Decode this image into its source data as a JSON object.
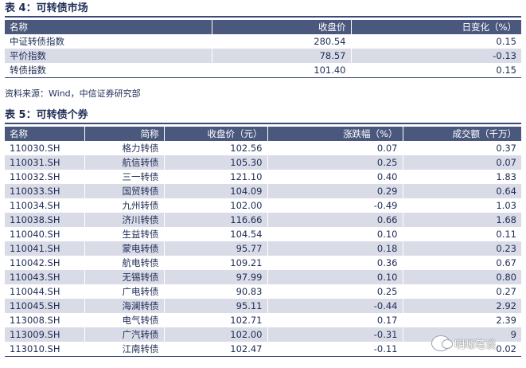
{
  "table4": {
    "title": "表 4：可转债市场",
    "headers": [
      "名称",
      "收盘价",
      "日变化（%）"
    ],
    "rows": [
      [
        "中证转债指数",
        "280.54",
        "0.15"
      ],
      [
        "平价指数",
        "78.57",
        "-0.13"
      ],
      [
        "转债指数",
        "101.40",
        "0.15"
      ]
    ]
  },
  "source": "资料来源：Wind，中信证券研究部",
  "table5": {
    "title": "表 5：可转债个券",
    "headers": [
      "名称",
      "简称",
      "收盘价（元）",
      "涨跌幅（%）",
      "成交额（千万）"
    ],
    "rows": [
      [
        "110030.SH",
        "格力转债",
        "102.56",
        "0.07",
        "0.37"
      ],
      [
        "110031.SH",
        "航信转债",
        "105.30",
        "0.25",
        "0.07"
      ],
      [
        "110032.SH",
        "三一转债",
        "121.10",
        "0.40",
        "1.83"
      ],
      [
        "110033.SH",
        "国贸转债",
        "104.09",
        "0.29",
        "0.64"
      ],
      [
        "110034.SH",
        "九州转债",
        "102.00",
        "-0.49",
        "1.03"
      ],
      [
        "110038.SH",
        "济川转债",
        "116.66",
        "0.66",
        "1.68"
      ],
      [
        "110040.SH",
        "生益转债",
        "104.54",
        "0.10",
        "0.11"
      ],
      [
        "110041.SH",
        "蒙电转债",
        "95.77",
        "0.18",
        "0.23"
      ],
      [
        "110042.SH",
        "航电转债",
        "109.21",
        "0.36",
        "0.67"
      ],
      [
        "110043.SH",
        "无锡转债",
        "97.99",
        "0.10",
        "0.80"
      ],
      [
        "110044.SH",
        "广电转债",
        "90.83",
        "0.25",
        "0.27"
      ],
      [
        "110045.SH",
        "海澜转债",
        "95.11",
        "-0.44",
        "2.92"
      ],
      [
        "113008.SH",
        "电气转债",
        "102.71",
        "0.17",
        "2.39"
      ],
      [
        "113009.SH",
        "广汽转债",
        "102.00",
        "-0.31",
        "9"
      ],
      [
        "113010.SH",
        "江南转债",
        "102.47",
        "-0.11",
        "0.02"
      ]
    ]
  },
  "watermark": "明晰笔谈"
}
